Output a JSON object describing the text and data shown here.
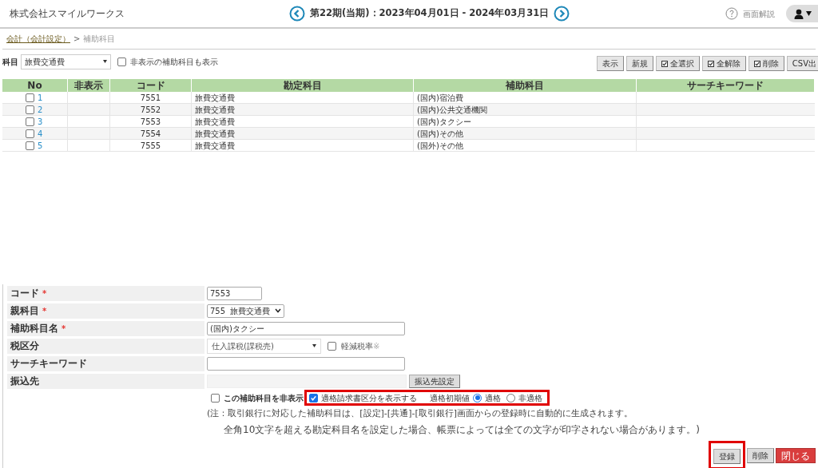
{
  "header": {
    "company": "株式会社スマイルワークス",
    "period": "第22期(当期)：2023年04月01日 - 2024年03月31日",
    "help": "画面解説"
  },
  "breadcrumb": {
    "link": "会計（会計設定）",
    "separator": ">",
    "current": "補助科目"
  },
  "filter": {
    "label": "科目",
    "value": "旅費交通費",
    "show_hidden": {
      "label": "非表示の補助科目も表示",
      "checked": false
    }
  },
  "toolbar": [
    {
      "label": "表示",
      "kind": "plain"
    },
    {
      "label": "新規",
      "kind": "plain"
    },
    {
      "label": "全選択",
      "kind": "check"
    },
    {
      "label": "全解除",
      "kind": "check"
    },
    {
      "label": "削除",
      "kind": "check"
    },
    {
      "label": "CSV出",
      "kind": "plain"
    }
  ],
  "table": {
    "columns": [
      "No",
      "非表示",
      "コード",
      "勘定科目",
      "補助科目",
      "サーチキーワード"
    ],
    "rows": [
      {
        "checked": false,
        "no": "1",
        "code": "7551",
        "account": "旅費交通費",
        "sub_account": "(国内)宿泊費"
      },
      {
        "checked": false,
        "no": "2",
        "code": "7552",
        "account": "旅費交通費",
        "sub_account": "(国内)公共交通機関"
      },
      {
        "checked": false,
        "no": "3",
        "code": "7553",
        "account": "旅費交通費",
        "sub_account": "(国内)タクシー"
      },
      {
        "checked": false,
        "no": "4",
        "code": "7554",
        "account": "旅費交通費",
        "sub_account": "(国内)その他"
      },
      {
        "checked": false,
        "no": "5",
        "code": "7555",
        "account": "旅費交通費",
        "sub_account": "(国外)その他"
      }
    ]
  },
  "form": {
    "fields": [
      {
        "label": "コード",
        "required_mark": "*",
        "kind": "text",
        "value": "7553"
      },
      {
        "label": "親科目",
        "required_mark": "*",
        "kind": "select",
        "value": "755  旅費交通費"
      },
      {
        "label": "補助科目名",
        "required_mark": "*",
        "kind": "text",
        "value": "(国内)タクシー"
      },
      {
        "label": "税区分",
        "kind": "tax",
        "value": "仕入課税(課税売)",
        "reduced": {
          "label": "軽減税率",
          "mark": "※",
          "checked": false
        }
      },
      {
        "label": "サーチキーワード",
        "kind": "text"
      },
      {
        "label": "振込先",
        "kind": "bank",
        "button": "振込先設定"
      }
    ],
    "hide_option": {
      "label": "この補助科目を非表示",
      "checked": false
    },
    "invoice": {
      "highlighted": true,
      "label": "適格請求書区分を表示する",
      "checked": true,
      "default_label": "適格初期値",
      "options": [
        {
          "label": "適格",
          "selected": true
        },
        {
          "label": "非適格",
          "selected": false
        }
      ]
    },
    "notes": [
      "(注：取引銀行に対応した補助科目は、[設定]-[共通]-[取引銀行]画面からの登録時に自動的に生成されます。",
      "全角10文字を超える勘定科目名を設定した場合、帳票によっては全ての文字が印字されない場合があります。)"
    ],
    "buttons": [
      {
        "label": "登録",
        "kind": "default",
        "highlighted": true
      },
      {
        "label": "削除",
        "kind": "default",
        "highlighted": false
      },
      {
        "label": "閉じる",
        "kind": "danger",
        "highlighted": false
      }
    ]
  }
}
